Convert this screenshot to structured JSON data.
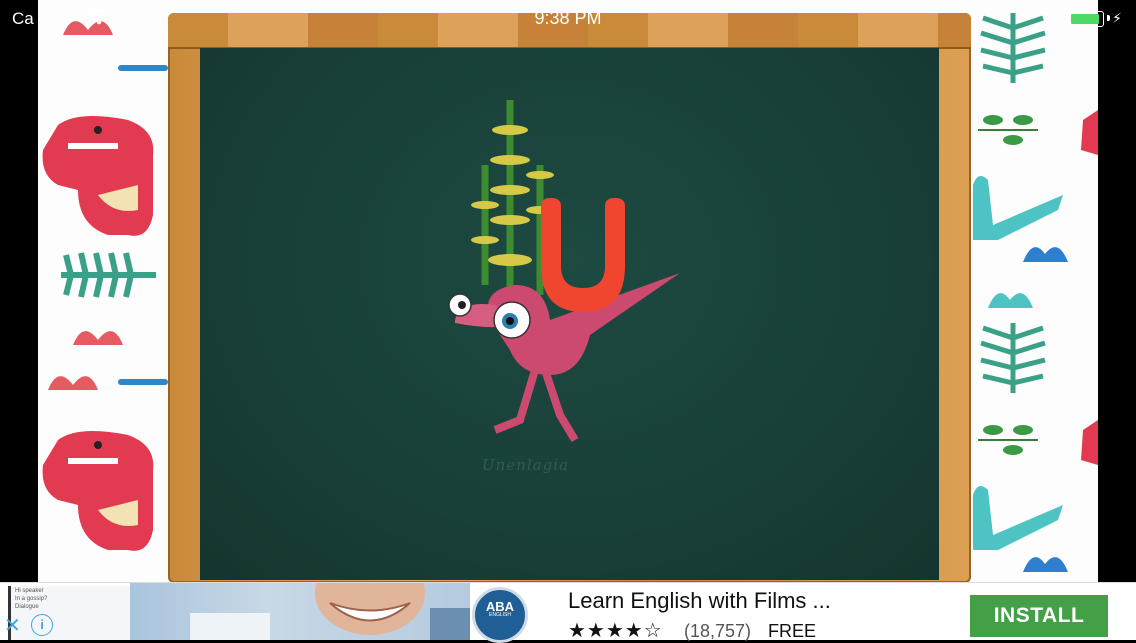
{
  "status_bar": {
    "carrier": "Ca",
    "time": "9:38 PM",
    "battery_level": 0.95
  },
  "game": {
    "letter": "U",
    "dinosaur_caption": "Unenlagia"
  },
  "ad": {
    "title": "Learn English with Films ...",
    "rating_stars": "★★★★☆",
    "rating_count": "(18,757)",
    "price": "FREE",
    "install_label": "INSTALL",
    "logo_text": "ABA",
    "logo_sub": "ENGLISH",
    "close_symbol": "✕",
    "info_symbol": "i",
    "paper_lines": [
      "Hi speaker",
      "In a gossip?",
      "Dialogue"
    ]
  },
  "colors": {
    "board": "#183f38",
    "frame": "#d79a4f",
    "letter": "#f0452e",
    "install": "#43a047"
  }
}
